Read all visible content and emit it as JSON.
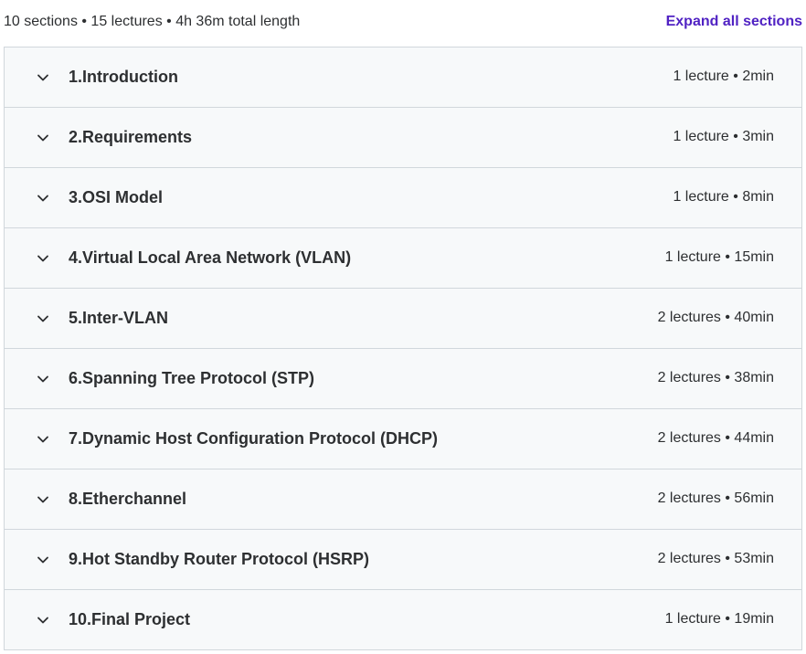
{
  "summary": {
    "text": "10 sections • 15 lectures • 4h 36m total length",
    "expand_label": "Expand all sections"
  },
  "colors": {
    "accent": "#5022c3",
    "row_background": "#f7f9fa",
    "border": "#d1d7dc",
    "text": "#2d2f31"
  },
  "icons": {
    "chevron": "chevron-down-icon"
  },
  "sections": [
    {
      "title": "1.Introduction",
      "meta": "1 lecture • 2min"
    },
    {
      "title": "2.Requirements",
      "meta": "1 lecture • 3min"
    },
    {
      "title": "3.OSI Model",
      "meta": "1 lecture • 8min"
    },
    {
      "title": "4.Virtual Local Area Network (VLAN)",
      "meta": "1 lecture • 15min"
    },
    {
      "title": "5.Inter-VLAN",
      "meta": "2 lectures • 40min"
    },
    {
      "title": "6.Spanning Tree Protocol (STP)",
      "meta": "2 lectures • 38min"
    },
    {
      "title": "7.Dynamic Host Configuration Protocol (DHCP)",
      "meta": "2 lectures • 44min"
    },
    {
      "title": "8.Etherchannel",
      "meta": "2 lectures • 56min"
    },
    {
      "title": "9.Hot Standby Router Protocol (HSRP)",
      "meta": "2 lectures • 53min"
    },
    {
      "title": "10.Final Project",
      "meta": "1 lecture • 19min"
    }
  ]
}
